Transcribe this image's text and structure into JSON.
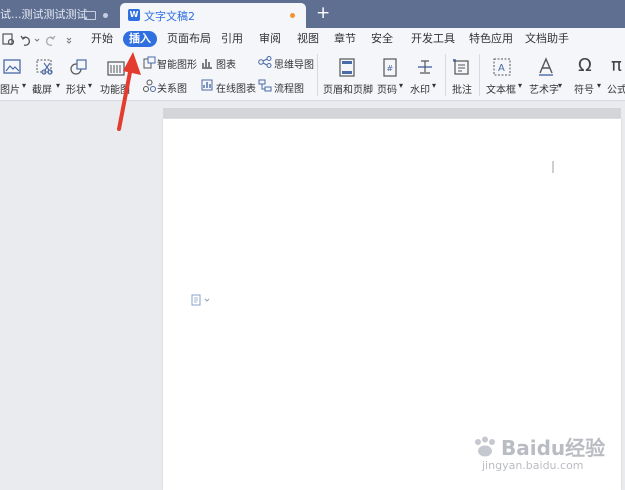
{
  "tabs": [
    {
      "label": "试...测试测试测试"
    },
    {
      "label": "文字文稿2"
    }
  ],
  "new_tab": "+",
  "menu": {
    "start": "开始",
    "insert": "插入",
    "layout": "页面布局",
    "reference": "引用",
    "review": "审阅",
    "view": "视图",
    "section": "章节",
    "security": "安全",
    "devtools": "开发工具",
    "features": "特色应用",
    "assistant": "文档助手"
  },
  "ribbon": {
    "picture": "图片",
    "screenshot": "截屏",
    "shape": "形状",
    "function_chart": "功能图",
    "smart_graphic": "智能图形",
    "chart": "图表",
    "mindmap": "思维导图",
    "relation": "关系图",
    "online_chart": "在线图表",
    "flowchart": "流程图",
    "header_footer": "页眉和页脚",
    "page_number": "页码",
    "watermark": "水印",
    "comment": "批注",
    "textbox": "文本框",
    "wordart": "艺术字",
    "symbol": "符号",
    "formula": "公式"
  },
  "watermark": {
    "brand": "Baidu经验",
    "url": "jingyan.baidu.com"
  },
  "colors": {
    "tabbar": "#5f6f92",
    "accent": "#2f6fe0",
    "arrow": "#e33b2e"
  }
}
